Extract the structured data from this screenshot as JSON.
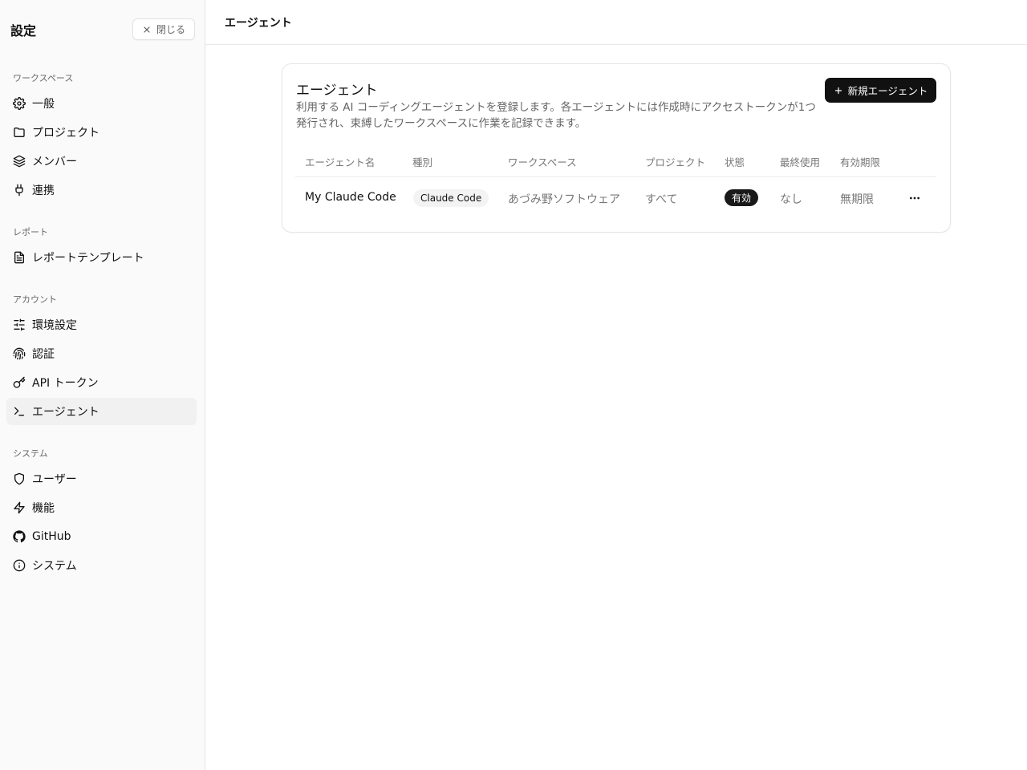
{
  "sidebar": {
    "title": "設定",
    "close_label": "閉じる",
    "sections": [
      {
        "label": "ワークスペース",
        "items": [
          {
            "label": "一般",
            "icon": "gear-icon"
          },
          {
            "label": "プロジェクト",
            "icon": "folder-icon"
          },
          {
            "label": "メンバー",
            "icon": "layers-icon"
          },
          {
            "label": "連携",
            "icon": "plug-icon"
          }
        ]
      },
      {
        "label": "レポート",
        "items": [
          {
            "label": "レポートテンプレート",
            "icon": "file-text-icon"
          }
        ]
      },
      {
        "label": "アカウント",
        "items": [
          {
            "label": "環境設定",
            "icon": "sliders-icon"
          },
          {
            "label": "認証",
            "icon": "fingerprint-icon"
          },
          {
            "label": "API トークン",
            "icon": "key-icon"
          },
          {
            "label": "エージェント",
            "icon": "terminal-icon",
            "active": true
          }
        ]
      },
      {
        "label": "システム",
        "items": [
          {
            "label": "ユーザー",
            "icon": "shield-icon"
          },
          {
            "label": "機能",
            "icon": "zap-icon"
          },
          {
            "label": "GitHub",
            "icon": "github-icon"
          },
          {
            "label": "システム",
            "icon": "info-icon"
          }
        ]
      }
    ]
  },
  "header": {
    "title": "エージェント"
  },
  "card": {
    "title": "エージェント",
    "description": "利用する AI コーディングエージェントを登録します。各エージェントには作成時にアクセストークンが1つ発行され、束縛したワークスペースに作業を記録できます。",
    "new_button_label": "新規エージェント",
    "columns": [
      "エージェント名",
      "種別",
      "ワークスペース",
      "プロジェクト",
      "状態",
      "最終使用",
      "有効期限"
    ],
    "rows": [
      {
        "name": "My Claude Code",
        "type": "Claude Code",
        "workspace": "あづみ野ソフトウェア",
        "project": "すべて",
        "status": "有効",
        "last_used": "なし",
        "expires": "無期限"
      }
    ]
  },
  "colors": {
    "accent": "#111111",
    "sidebar_bg": "#fafafa",
    "muted_text": "#777777"
  }
}
